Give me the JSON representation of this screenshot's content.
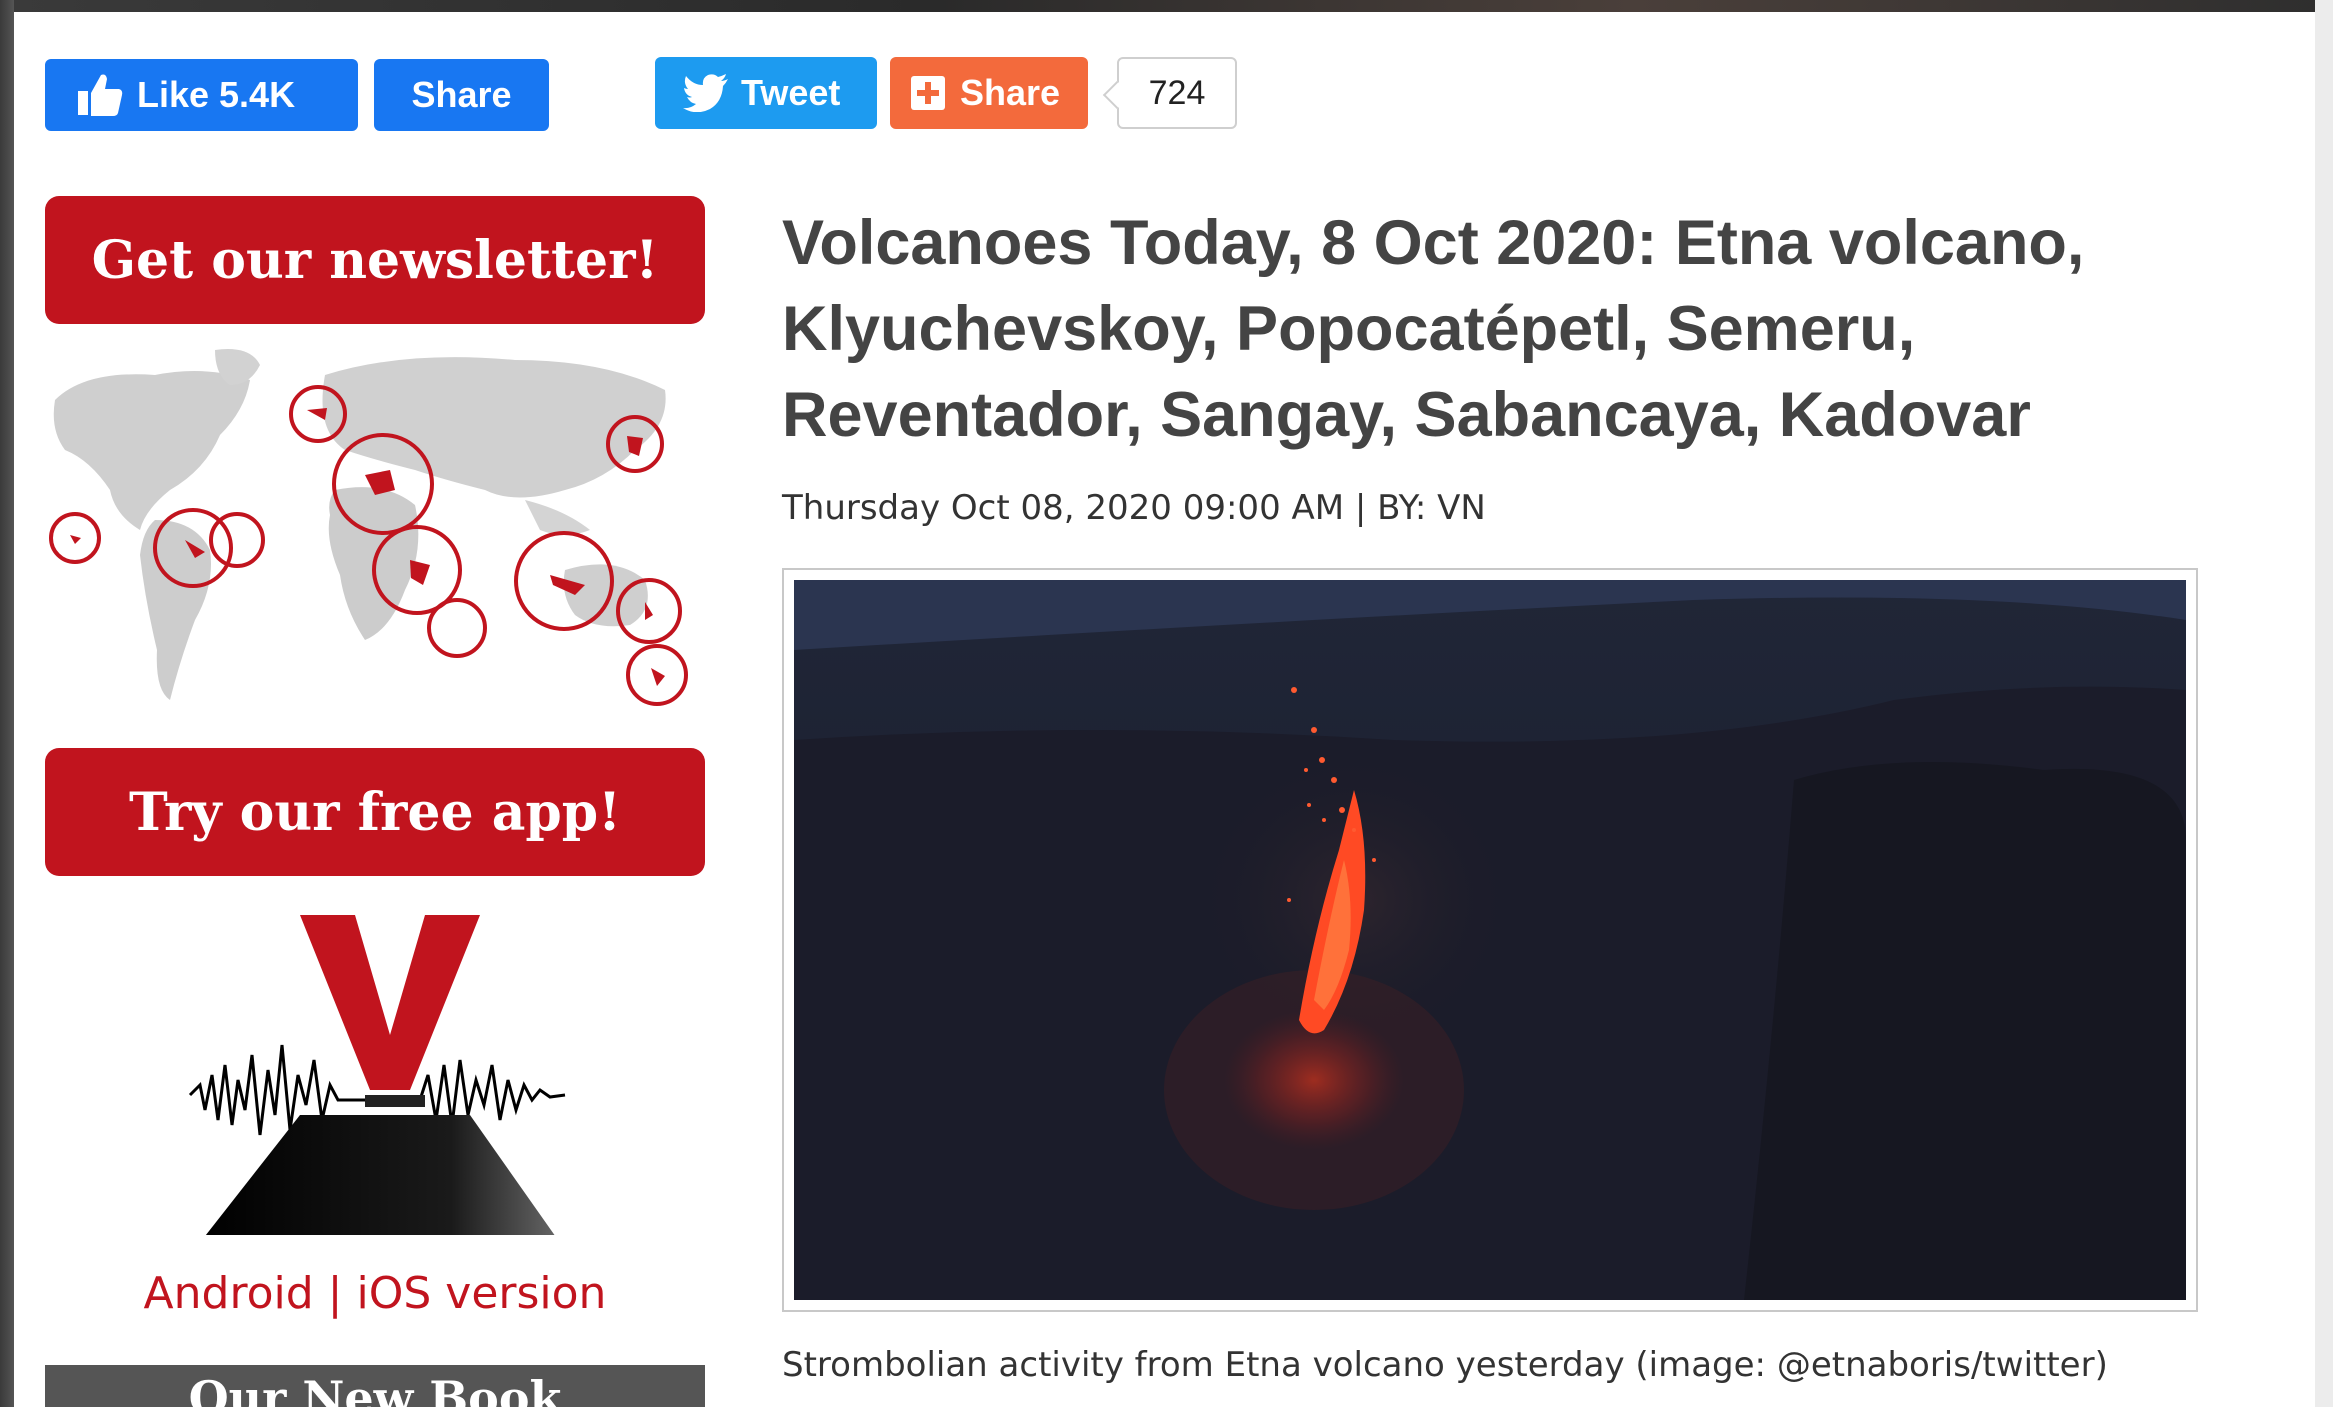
{
  "social": {
    "fb_like_label": "Like 5.4K",
    "fb_share_label": "Share",
    "tweet_label": "Tweet",
    "share_label": "Share",
    "share_count": "724"
  },
  "sidebar": {
    "newsletter_button": "Get our newsletter!",
    "app_button": "Try our free app!",
    "android_link": "Android",
    "separator": "|",
    "ios_link": "iOS version",
    "book_heading": "Our New Book"
  },
  "article": {
    "title": "Volcanoes Today, 8 Oct 2020: Etna volcano, Klyuchevskoy, Popocatépetl, Semeru, Reventador, Sangay, Sabancaya, Kadovar",
    "meta": "Thursday Oct 08, 2020 09:00 AM | BY: VN",
    "caption": "Strombolian activity from Etna volcano yesterday (image: @etnaboris/twitter)"
  },
  "colors": {
    "facebook": "#1877f2",
    "twitter": "#1d9bf0",
    "share": "#f36a3c",
    "brand_red": "#c1141e"
  },
  "icons": [
    "thumbs-up-icon",
    "twitter-bird-icon",
    "plus-box-icon",
    "world-map-icon",
    "volcano-logo-icon"
  ]
}
